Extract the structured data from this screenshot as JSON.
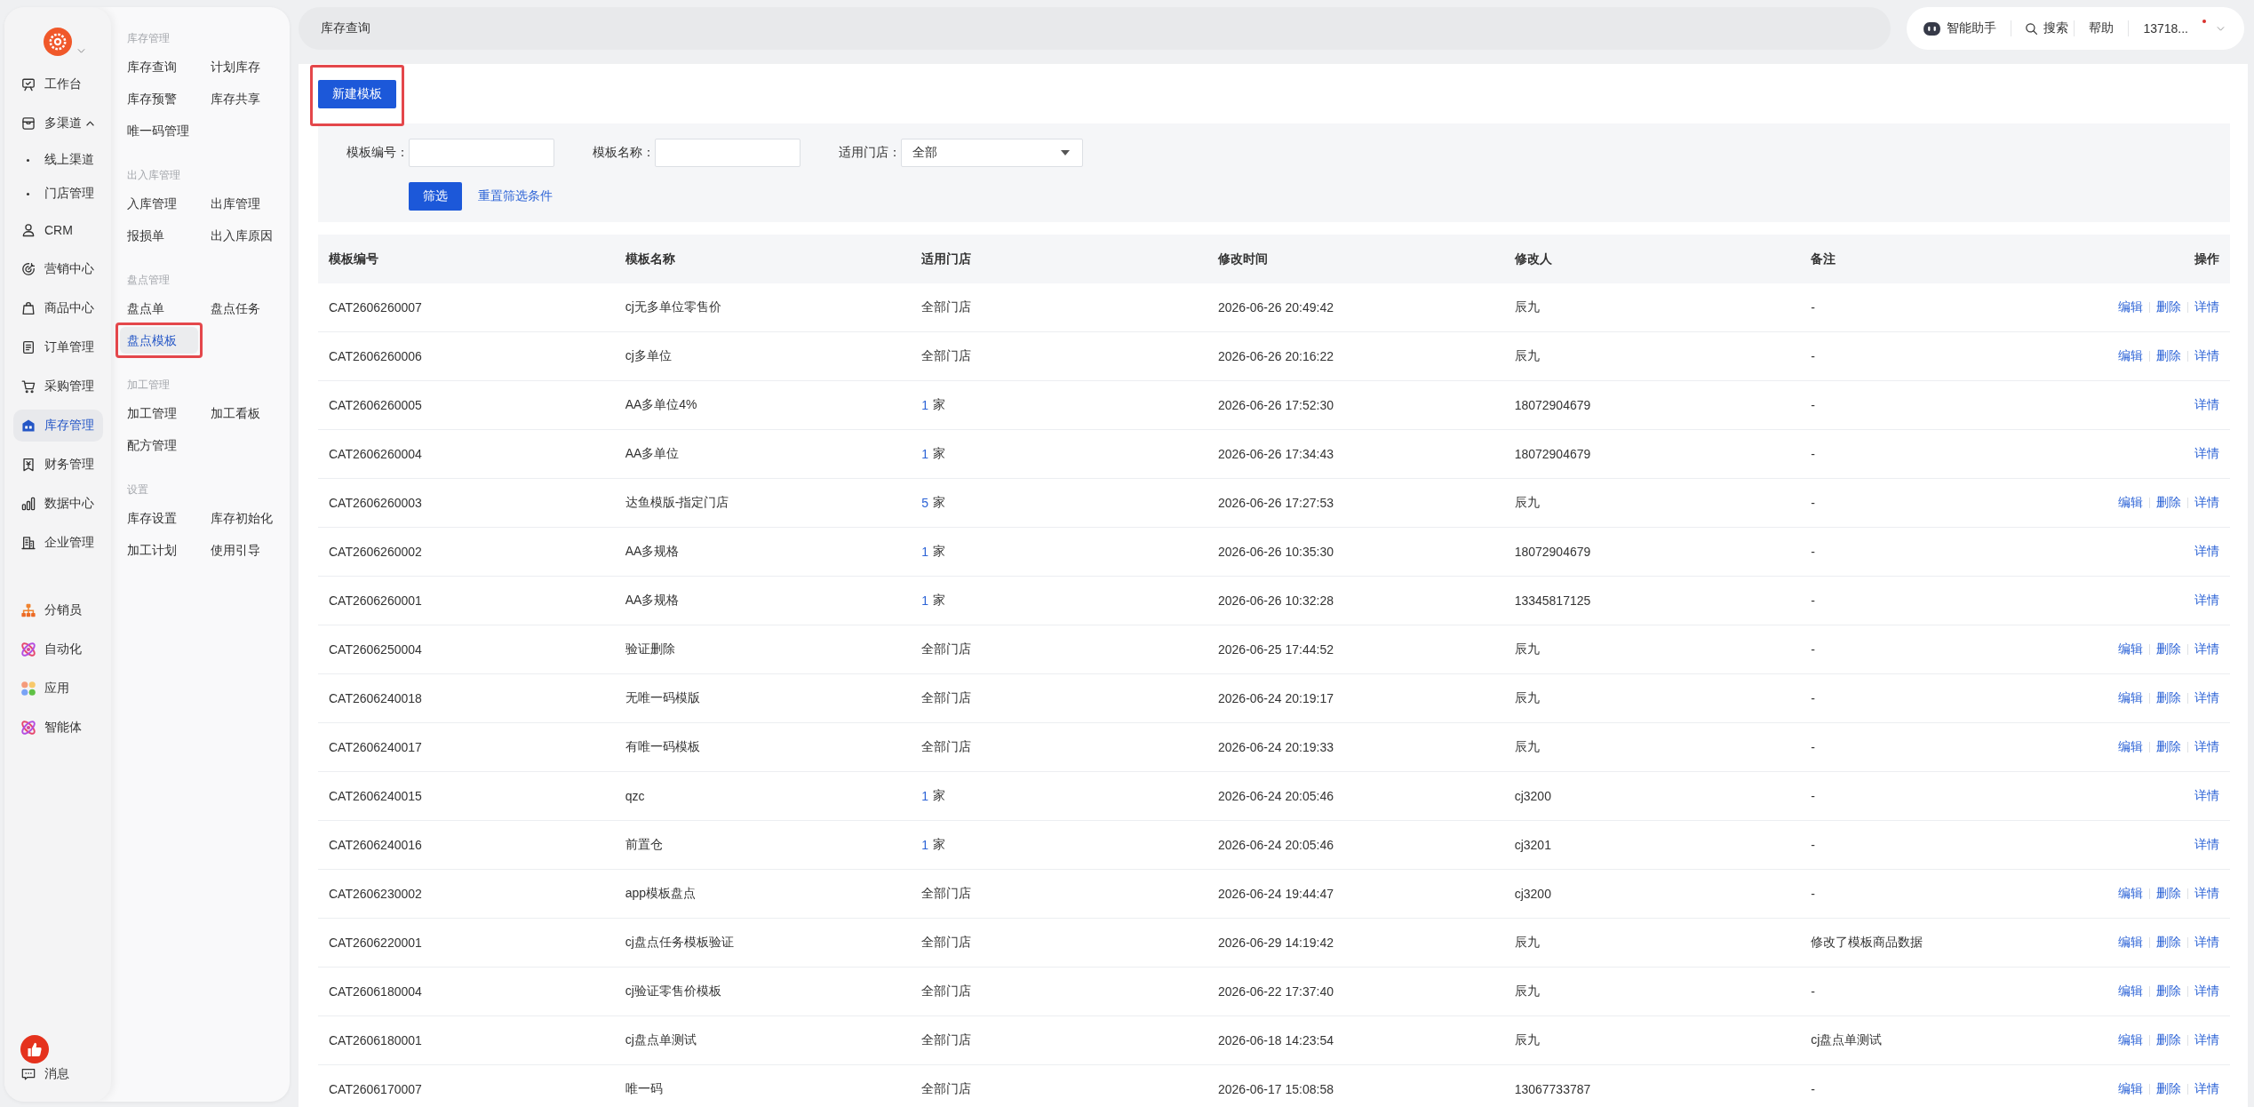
{
  "sidebar": {
    "nav": [
      {
        "label": "工作台",
        "selected": false
      },
      {
        "label": "多渠道",
        "selected": false,
        "expanded": true,
        "children": [
          {
            "label": "线上渠道",
            "selected": false
          },
          {
            "label": "门店管理",
            "selected": false
          }
        ]
      },
      {
        "label": "CRM",
        "selected": false
      },
      {
        "label": "营销中心",
        "selected": false
      },
      {
        "label": "商品中心",
        "selected": false
      },
      {
        "label": "订单管理",
        "selected": false
      },
      {
        "label": "采购管理",
        "selected": false
      },
      {
        "label": "库存管理",
        "selected": true
      },
      {
        "label": "财务管理",
        "selected": false
      },
      {
        "label": "数据中心",
        "selected": false
      },
      {
        "label": "企业管理",
        "selected": false
      }
    ],
    "apps": [
      {
        "label": "分销员",
        "selected": false
      },
      {
        "label": "自动化",
        "selected": false
      },
      {
        "label": "应用",
        "selected": false
      },
      {
        "label": "智能体",
        "selected": false
      }
    ],
    "messages": {
      "label": "消息"
    }
  },
  "submenu": [
    {
      "title": "库存管理",
      "items": [
        {
          "label": "库存查询",
          "selected": false,
          "highlighted": false
        },
        {
          "label": "计划库存",
          "selected": false,
          "highlighted": false
        },
        {
          "label": "库存预警",
          "selected": false,
          "highlighted": false
        },
        {
          "label": "库存共享",
          "selected": false,
          "highlighted": false
        },
        {
          "label": "唯一码管理",
          "selected": false,
          "highlighted": false
        }
      ]
    },
    {
      "title": "出入库管理",
      "items": [
        {
          "label": "入库管理",
          "selected": false,
          "highlighted": false
        },
        {
          "label": "出库管理",
          "selected": false,
          "highlighted": false
        },
        {
          "label": "报损单",
          "selected": false,
          "highlighted": false
        },
        {
          "label": "出入库原因",
          "selected": false,
          "highlighted": false
        }
      ]
    },
    {
      "title": "盘点管理",
      "items": [
        {
          "label": "盘点单",
          "selected": false,
          "highlighted": false
        },
        {
          "label": "盘点任务",
          "selected": false,
          "highlighted": false
        },
        {
          "label": "盘点模板",
          "selected": true,
          "highlighted": true
        }
      ]
    },
    {
      "title": "加工管理",
      "items": [
        {
          "label": "加工管理",
          "selected": false,
          "highlighted": false
        },
        {
          "label": "加工看板",
          "selected": false,
          "highlighted": false
        },
        {
          "label": "配方管理",
          "selected": false,
          "highlighted": false
        }
      ]
    },
    {
      "title": "设置",
      "items": [
        {
          "label": "库存设置",
          "selected": false,
          "highlighted": false
        },
        {
          "label": "库存初始化",
          "selected": false,
          "highlighted": false
        },
        {
          "label": "加工计划",
          "selected": false,
          "highlighted": false
        },
        {
          "label": "使用引导",
          "selected": false,
          "highlighted": false
        }
      ]
    }
  ],
  "page_tab": {
    "label": "库存查询"
  },
  "header_actions": [
    {
      "kind": "assistant",
      "label": "智能助手"
    },
    {
      "kind": "search",
      "label": "搜索"
    },
    {
      "kind": "help",
      "label": "帮助"
    }
  ],
  "account": {
    "label": "13718...",
    "unread": true
  },
  "toolbar": {
    "new_button": {
      "label": "新建模板",
      "highlighted": true
    }
  },
  "filters": {
    "fields": [
      {
        "kind": "text",
        "label": "模板编号："
      },
      {
        "kind": "text",
        "label": "模板名称："
      },
      {
        "kind": "select",
        "label": "适用门店：",
        "value": "全部"
      }
    ],
    "submit": "筛选",
    "reset": "重置筛选条件"
  },
  "table": {
    "columns": [
      "模板编号",
      "模板名称",
      "适用门店",
      "修改时间",
      "修改人",
      "备注",
      "操作"
    ],
    "rows": [
      {
        "code": "CAT2606260007",
        "name": "cj无多单位零售价",
        "store": {
          "kind": "all",
          "text": "全部门店"
        },
        "modified": "2026-06-26 20:49:42",
        "modifier": "辰九",
        "note": "-",
        "actions": [
          "编辑",
          "删除",
          "详情"
        ]
      },
      {
        "code": "CAT2606260006",
        "name": "cj多单位",
        "store": {
          "kind": "all",
          "text": "全部门店"
        },
        "modified": "2026-06-26 20:16:22",
        "modifier": "辰九",
        "note": "-",
        "actions": [
          "编辑",
          "删除",
          "详情"
        ]
      },
      {
        "code": "CAT2606260005",
        "name": "AA多单位4%",
        "store": {
          "kind": "count",
          "count": "1",
          "unit": "家"
        },
        "modified": "2026-06-26 17:52:30",
        "modifier": "18072904679",
        "note": "-",
        "actions": [
          "详情"
        ]
      },
      {
        "code": "CAT2606260004",
        "name": "AA多单位",
        "store": {
          "kind": "count",
          "count": "1",
          "unit": "家"
        },
        "modified": "2026-06-26 17:34:43",
        "modifier": "18072904679",
        "note": "-",
        "actions": [
          "详情"
        ]
      },
      {
        "code": "CAT2606260003",
        "name": "达鱼模版-指定门店",
        "store": {
          "kind": "count",
          "count": "5",
          "unit": "家"
        },
        "modified": "2026-06-26 17:27:53",
        "modifier": "辰九",
        "note": "-",
        "actions": [
          "编辑",
          "删除",
          "详情"
        ]
      },
      {
        "code": "CAT2606260002",
        "name": "AA多规格",
        "store": {
          "kind": "count",
          "count": "1",
          "unit": "家"
        },
        "modified": "2026-06-26 10:35:30",
        "modifier": "18072904679",
        "note": "-",
        "actions": [
          "详情"
        ]
      },
      {
        "code": "CAT2606260001",
        "name": "AA多规格",
        "store": {
          "kind": "count",
          "count": "1",
          "unit": "家"
        },
        "modified": "2026-06-26 10:32:28",
        "modifier": "13345817125",
        "note": "-",
        "actions": [
          "详情"
        ]
      },
      {
        "code": "CAT2606250004",
        "name": "验证删除",
        "store": {
          "kind": "all",
          "text": "全部门店"
        },
        "modified": "2026-06-25 17:44:52",
        "modifier": "辰九",
        "note": "-",
        "actions": [
          "编辑",
          "删除",
          "详情"
        ]
      },
      {
        "code": "CAT2606240018",
        "name": "无唯一码模版",
        "store": {
          "kind": "all",
          "text": "全部门店"
        },
        "modified": "2026-06-24 20:19:17",
        "modifier": "辰九",
        "note": "-",
        "actions": [
          "编辑",
          "删除",
          "详情"
        ]
      },
      {
        "code": "CAT2606240017",
        "name": "有唯一码模板",
        "store": {
          "kind": "all",
          "text": "全部门店"
        },
        "modified": "2026-06-24 20:19:33",
        "modifier": "辰九",
        "note": "-",
        "actions": [
          "编辑",
          "删除",
          "详情"
        ]
      },
      {
        "code": "CAT2606240015",
        "name": "qzc",
        "store": {
          "kind": "count",
          "count": "1",
          "unit": "家"
        },
        "modified": "2026-06-24 20:05:46",
        "modifier": "cj3200",
        "note": "-",
        "actions": [
          "详情"
        ]
      },
      {
        "code": "CAT2606240016",
        "name": "前置仓",
        "store": {
          "kind": "count",
          "count": "1",
          "unit": "家"
        },
        "modified": "2026-06-24 20:05:46",
        "modifier": "cj3201",
        "note": "-",
        "actions": [
          "详情"
        ]
      },
      {
        "code": "CAT2606230002",
        "name": "app模板盘点",
        "store": {
          "kind": "all",
          "text": "全部门店"
        },
        "modified": "2026-06-24 19:44:47",
        "modifier": "cj3200",
        "note": "-",
        "actions": [
          "编辑",
          "删除",
          "详情"
        ]
      },
      {
        "code": "CAT2606220001",
        "name": "cj盘点任务模板验证",
        "store": {
          "kind": "all",
          "text": "全部门店"
        },
        "modified": "2026-06-29 14:19:42",
        "modifier": "辰九",
        "note": "修改了模板商品数据",
        "actions": [
          "编辑",
          "删除",
          "详情"
        ]
      },
      {
        "code": "CAT2606180004",
        "name": "cj验证零售价模板",
        "store": {
          "kind": "all",
          "text": "全部门店"
        },
        "modified": "2026-06-22 17:37:40",
        "modifier": "辰九",
        "note": "-",
        "actions": [
          "编辑",
          "删除",
          "详情"
        ]
      },
      {
        "code": "CAT2606180001",
        "name": "cj盘点单测试",
        "store": {
          "kind": "all",
          "text": "全部门店"
        },
        "modified": "2026-06-18 14:23:54",
        "modifier": "辰九",
        "note": "cj盘点单测试",
        "actions": [
          "编辑",
          "删除",
          "详情"
        ]
      },
      {
        "code": "CAT2606170007",
        "name": "唯一码",
        "store": {
          "kind": "all",
          "text": "全部门店"
        },
        "modified": "2026-06-17 15:08:58",
        "modifier": "13067733787",
        "note": "-",
        "actions": [
          "编辑",
          "删除",
          "详情"
        ]
      }
    ]
  }
}
